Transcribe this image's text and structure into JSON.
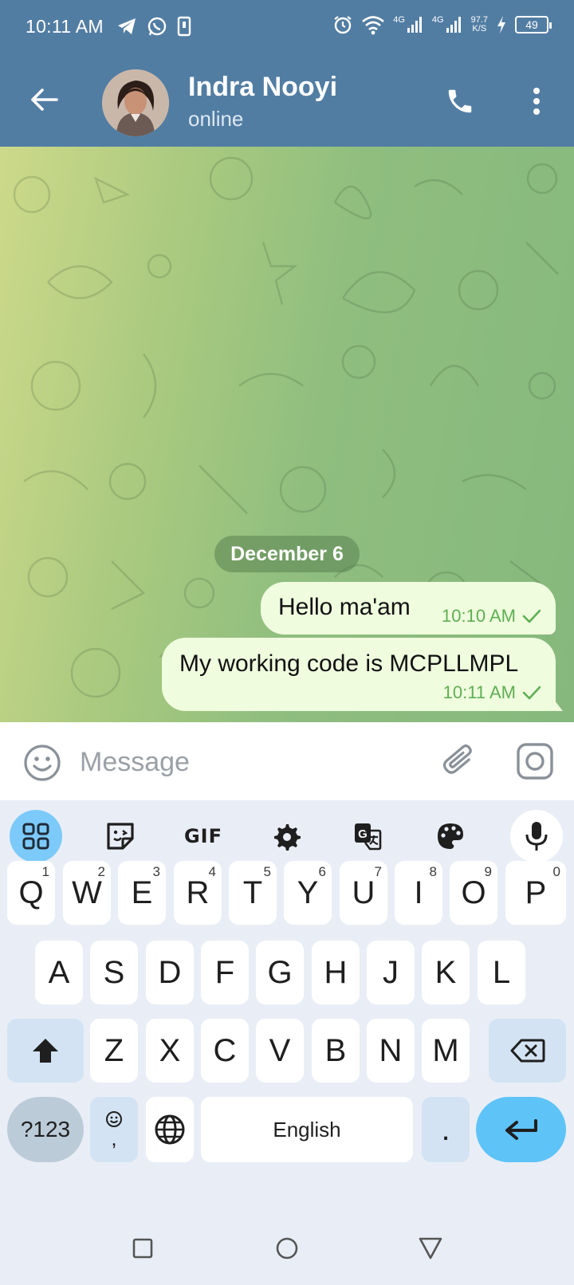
{
  "status_bar": {
    "time": "10:11 AM",
    "network_1": "4G",
    "network_2": "4G",
    "speed_value": "97.7",
    "speed_unit": "K/S",
    "battery": "49"
  },
  "header": {
    "contact_name": "Indra Nooyi",
    "contact_status": "online"
  },
  "chat": {
    "date_separator": "December 6",
    "messages": [
      {
        "text": "Hello ma'am",
        "time": "10:10 AM",
        "status": "sent"
      },
      {
        "text": "My working code is MCPLLMPL",
        "time": "10:11 AM",
        "status": "sent"
      }
    ]
  },
  "input": {
    "placeholder": "Message"
  },
  "keyboard": {
    "toolbar": {
      "gif_label": "GIF"
    },
    "row1": [
      {
        "key": "Q",
        "hint": "1"
      },
      {
        "key": "W",
        "hint": "2"
      },
      {
        "key": "E",
        "hint": "3"
      },
      {
        "key": "R",
        "hint": "4"
      },
      {
        "key": "T",
        "hint": "5"
      },
      {
        "key": "Y",
        "hint": "6"
      },
      {
        "key": "U",
        "hint": "7"
      },
      {
        "key": "I",
        "hint": "8"
      },
      {
        "key": "O",
        "hint": "9"
      },
      {
        "key": "P",
        "hint": "0"
      }
    ],
    "row2": [
      "A",
      "S",
      "D",
      "F",
      "G",
      "H",
      "J",
      "K",
      "L"
    ],
    "row3": [
      "Z",
      "X",
      "C",
      "V",
      "B",
      "N",
      "M"
    ],
    "symbols_key": "?123",
    "comma_key": ",",
    "space_label": "English",
    "period_key": "."
  },
  "colors": {
    "header_bg": "#527da3",
    "bubble_out": "#effdde",
    "timestamp_green": "#5fae54",
    "keyboard_accent": "#5ec3f7"
  }
}
